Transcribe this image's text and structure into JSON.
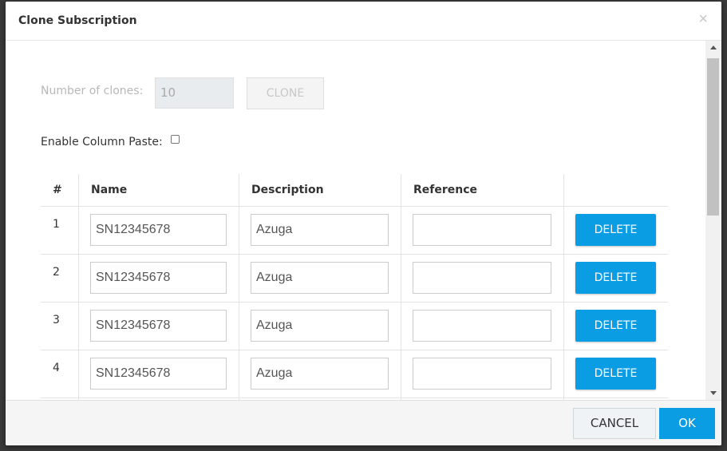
{
  "dialog": {
    "title": "Clone Subscription",
    "close_glyph": "×"
  },
  "clone_controls": {
    "number_label": "Number of clones:",
    "number_value": "10",
    "clone_button": "CLONE",
    "paste_label": "Enable Column Paste:",
    "paste_checked": false
  },
  "table": {
    "headers": [
      "#",
      "Name",
      "Description",
      "Reference",
      ""
    ],
    "rows": [
      {
        "num": "1",
        "name": "SN12345678",
        "description": "Azuga",
        "reference": "",
        "delete": "DELETE"
      },
      {
        "num": "2",
        "name": "SN12345678",
        "description": "Azuga",
        "reference": "",
        "delete": "DELETE"
      },
      {
        "num": "3",
        "name": "SN12345678",
        "description": "Azuga",
        "reference": "",
        "delete": "DELETE"
      },
      {
        "num": "4",
        "name": "SN12345678",
        "description": "Azuga",
        "reference": "",
        "delete": "DELETE"
      }
    ]
  },
  "footer": {
    "cancel": "CANCEL",
    "ok": "OK"
  },
  "colors": {
    "accent": "#0b9de4",
    "disabled_text": "#b8b8b8"
  }
}
